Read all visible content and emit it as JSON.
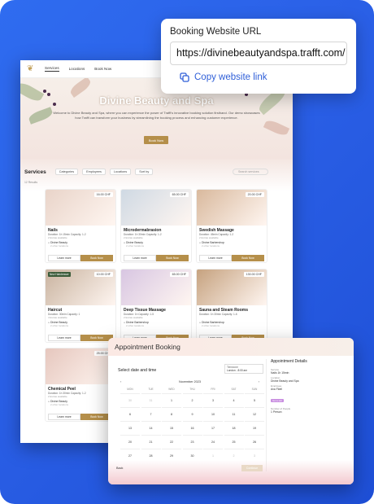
{
  "site": {
    "nav": [
      "Services",
      "Locations",
      "Book Now"
    ],
    "title": "Divine Beauty and Spa",
    "description": "Welcome to Divine Beauty and Spa, where you can experience the power of Trafft's innovative booking solution firsthand. Our demo showcases how Trafft can transform your business by streamlining the booking process and enhancing customer experience.",
    "hero_button": "Book Now",
    "services_heading": "Services",
    "filters": [
      "Categories",
      "Employees",
      "Locations",
      "Sort by"
    ],
    "search_placeholder": "Search services",
    "results": "12 Results",
    "learn_more": "Learn more",
    "book_now": "Book Now",
    "cards": [
      {
        "name": "Nails",
        "price": "16.00 CHF",
        "meta": "Duration: 1h 15min  Capacity: 1-2",
        "extra": "2 Extras available",
        "location": "Divine Beauty",
        "location_sub": "2 other locations",
        "color": "#e9d4c9"
      },
      {
        "name": "Microdermabrasion",
        "price": "65.00 CHF",
        "meta": "Duration: 1h 30min  Capacity: 1-2",
        "extra": "2 Extras available",
        "location": "Divine Beauty",
        "location_sub": "2 other locations",
        "color": "#cfd9e3"
      },
      {
        "name": "Swedish Massage",
        "price": "20.00 CHF",
        "meta": "Duration: 45min  Capacity: 1-2",
        "extra": "2 Extras available",
        "location": "Divine Barbershop",
        "location_sub": "2 other locations",
        "color": "#d9b99d"
      },
      {
        "name": "Haircut",
        "price": "10.00 CHF",
        "meta": "Duration: 30min  Capacity: 1",
        "extra": "4 Extras available",
        "location": "Divine Beauty",
        "location_sub": "2 other locations",
        "color": "#c9b39f",
        "tag": "New Hairdresser"
      },
      {
        "name": "Deep Tissue Massage",
        "price": "65.00 CHF",
        "meta": "Duration: 1h  Capacity: 1-5",
        "extra": "2 Extras available",
        "location": "Divine Barbershop",
        "location_sub": "2 other locations",
        "color": "#d8c6e2"
      },
      {
        "name": "Sauna and Steam Rooms",
        "price": "130.00 CHF",
        "meta": "Duration: 1h 30min  Capacity: 1-6",
        "extra": "",
        "location": "Divine Barbershop",
        "location_sub": "2 other locations",
        "color": "#c6a27f"
      },
      {
        "name": "Chemical Peel",
        "price": "25.00 CHF",
        "meta": "Duration: 1h 30min  Capacity: 1-2",
        "extra": "2 Extras available",
        "location": "Divine Beauty",
        "location_sub": "2 other locations",
        "color": "#e6c7be"
      }
    ]
  },
  "url_popup": {
    "label": "Booking Website URL",
    "url": "https://divinebeautyandspa.trafft.com/",
    "copy": "Copy website link",
    "icon": "copy-icon"
  },
  "booking": {
    "title": "Appointment Booking",
    "select_heading": "Select date and time",
    "timezone_label": "Timezone",
    "timezone": "London - 8:00 am",
    "month": "November 2023",
    "weekdays": [
      "MON",
      "TUE",
      "WED",
      "THU",
      "FRI",
      "SAT",
      "SUN"
    ],
    "rows": [
      [
        "30",
        "31",
        "1",
        "2",
        "3",
        "4",
        "5"
      ],
      [
        "6",
        "7",
        "8",
        "9",
        "10",
        "11",
        "12"
      ],
      [
        "13",
        "14",
        "15",
        "16",
        "17",
        "18",
        "19"
      ],
      [
        "20",
        "21",
        "22",
        "23",
        "24",
        "25",
        "26"
      ],
      [
        "27",
        "28",
        "29",
        "30",
        "1",
        "2",
        "3"
      ]
    ],
    "back": "Back",
    "continue": "Continue",
    "details_heading": "Appointment Details",
    "details": [
      {
        "label": "Service",
        "value": "Nails  1h 15min"
      },
      {
        "label": "Location",
        "value": "Divine Beauty and Spa"
      },
      {
        "label": "Employee",
        "value": "Ava Fidel"
      },
      {
        "label": "Number of People",
        "value": "1 Person"
      }
    ],
    "badge": "Get a slot"
  }
}
